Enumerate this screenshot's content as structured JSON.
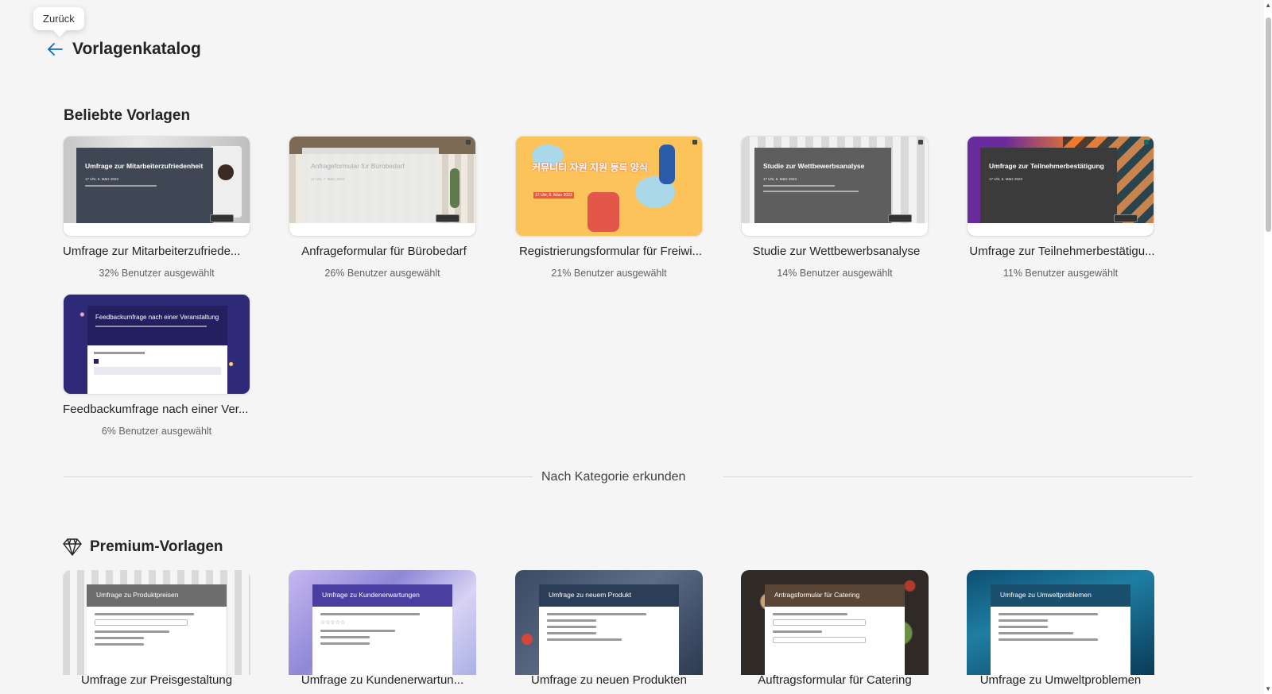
{
  "tooltip": "Zurück",
  "header": {
    "title": "Vorlagenkatalog"
  },
  "popular": {
    "title": "Beliebte Vorlagen",
    "cards": [
      {
        "name": "Umfrage zur Mitarbeiterzufriede...",
        "stat": "32% Benutzer ausgewählt",
        "thumb_title": "Umfrage zur Mitarbeiterzufriedenheit",
        "thumb_date": "17 Uhr, 6. März 2023"
      },
      {
        "name": "Anfrageformular für Bürobedarf",
        "stat": "26% Benutzer ausgewählt",
        "thumb_title": "Anfrageformular für Bürobedarf",
        "thumb_date": "17 Uhr, 7. März 2023"
      },
      {
        "name": "Registrierungsformular für Freiwi...",
        "stat": "21% Benutzer ausgewählt",
        "thumb_title": "커뮤니티 자원 지원 등록 양식",
        "thumb_date": "17 Uhr, 6. März 2023"
      },
      {
        "name": "Studie zur Wettbewerbsanalyse",
        "stat": "14% Benutzer ausgewählt",
        "thumb_title": "Studie zur Wettbewerbsanalyse",
        "thumb_date": "17 Uhr, 6. März 2023"
      },
      {
        "name": "Umfrage zur Teilnehmerbestätigu...",
        "stat": "11% Benutzer ausgewählt",
        "thumb_title": "Umfrage zur Teilnehmerbestätigung",
        "thumb_date": "17 Uhr, 6. März 2023"
      },
      {
        "name": "Feedbackumfrage nach einer Ver...",
        "stat": "6% Benutzer ausgewählt",
        "thumb_title": "Feedbackumfrage nach einer Veranstaltung",
        "thumb_date": ""
      }
    ]
  },
  "divider_label": "Nach Kategorie erkunden",
  "premium": {
    "title": "Premium-Vorlagen",
    "cards": [
      {
        "name": "Umfrage zur Preisgestaltung",
        "thumb_title": "Umfrage zu Produktpreisen"
      },
      {
        "name": "Umfrage zu Kundenerwartun...",
        "thumb_title": "Umfrage zu Kundenerwartungen"
      },
      {
        "name": "Umfrage zu neuen Produkten",
        "thumb_title": "Umfrage zu neuem Produkt"
      },
      {
        "name": "Auftragsformular für Catering",
        "thumb_title": "Antragsformular für Catering"
      },
      {
        "name": "Umfrage zu Umweltproblemen",
        "thumb_title": "Umfrage zu Umweltproblemen"
      }
    ]
  },
  "colors": {
    "accent": "#0f6cbd",
    "background": "#f5f5f5"
  },
  "icons": {
    "back": "arrow-left-icon",
    "premium": "diamond-icon"
  }
}
